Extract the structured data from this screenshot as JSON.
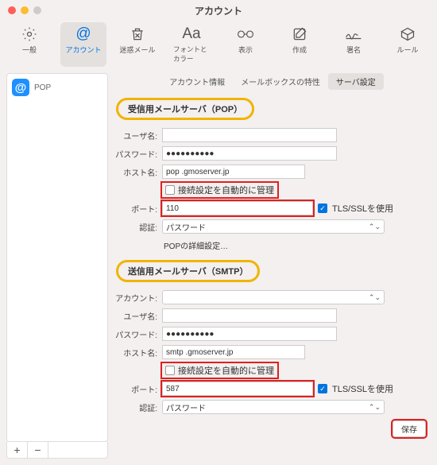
{
  "window": {
    "title": "アカウント"
  },
  "toolbar": {
    "items": [
      {
        "label": "一般"
      },
      {
        "label": "アカウント"
      },
      {
        "label": "迷惑メール"
      },
      {
        "label": "フォントとカラー"
      },
      {
        "label": "表示"
      },
      {
        "label": "作成"
      },
      {
        "label": "署名"
      },
      {
        "label": "ルール"
      }
    ]
  },
  "sidebar": {
    "account_type": "POP",
    "add": "+",
    "remove": "−"
  },
  "tabs": {
    "info": "アカウント情報",
    "mailbox": "メールボックスの特性",
    "server": "サーバ設定"
  },
  "incoming": {
    "heading": "受信用メールサーバ（POP）",
    "user_label": "ユーザ名:",
    "user_value": "",
    "pass_label": "パスワード:",
    "pass_value": "●●●●●●●●●●",
    "host_label": "ホスト名:",
    "host_value": "pop    .gmoserver.jp",
    "auto_label": "接続設定を自動的に管理",
    "port_label": "ポート:",
    "port_value": "110",
    "tls_label": "TLS/SSLを使用",
    "auth_label": "認証:",
    "auth_value": "パスワード",
    "advanced": "POPの詳細設定…"
  },
  "outgoing": {
    "heading": "送信用メールサーバ（SMTP）",
    "account_label": "アカウント:",
    "account_value": "",
    "user_label": "ユーザ名:",
    "user_value": "",
    "pass_label": "パスワード:",
    "pass_value": "●●●●●●●●●●",
    "host_label": "ホスト名:",
    "host_value": "smtp    .gmoserver.jp",
    "auto_label": "接続設定を自動的に管理",
    "port_label": "ポート:",
    "port_value": "587",
    "tls_label": "TLS/SSLを使用",
    "auth_label": "認証:",
    "auth_value": "パスワード"
  },
  "footer": {
    "save": "保存"
  }
}
